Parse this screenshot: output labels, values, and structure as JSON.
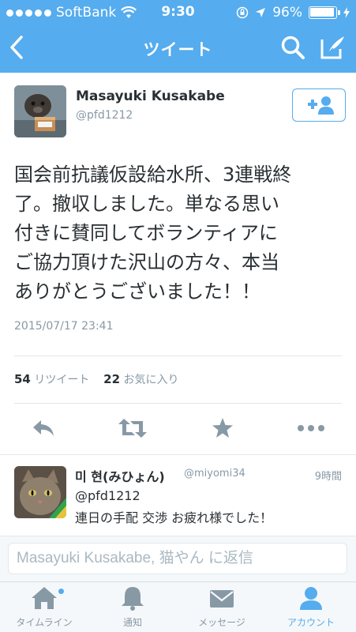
{
  "status_bar": {
    "carrier": "SoftBank",
    "time": "9:30",
    "battery": "96%"
  },
  "nav": {
    "title": "ツイート",
    "icons": [
      "back-icon",
      "search-icon",
      "compose-icon"
    ]
  },
  "tweet": {
    "author_name": "Masayuki Kusakabe",
    "author_handle": "@pfd1212",
    "text_lines": [
      "国会前抗議仮設給水所、3連戦終",
      "了。撤収しました。単なる思い",
      "付きに賛同してボランティアに",
      "ご協力頂けた沢山の方々、本当",
      "ありがとうございました！！"
    ],
    "timestamp": "2015/07/17 23:41",
    "retweet_count": "54",
    "retweet_label": "リツイート",
    "favorite_count": "22",
    "favorite_label": "お気に入り"
  },
  "reply": {
    "name": "미 현(みひょん)",
    "handle": "@miyomi34",
    "time": "9時間",
    "line1": "@pfd1212",
    "line2": "連日の手配 交渉 お疲れ様でした！"
  },
  "reply_input": {
    "placeholder": "Masayuki Kusakabe, 猫やん に返信"
  },
  "tabs": [
    {
      "label": "タイムライン",
      "icon": "home-icon",
      "active": false
    },
    {
      "label": "通知",
      "icon": "bell-icon",
      "active": false
    },
    {
      "label": "メッセージ",
      "icon": "envelope-icon",
      "active": false
    },
    {
      "label": "アカウント",
      "icon": "person-icon",
      "active": true
    }
  ],
  "colors": {
    "brand": "#55acee",
    "text": "#292f33",
    "muted": "#8899a6"
  }
}
